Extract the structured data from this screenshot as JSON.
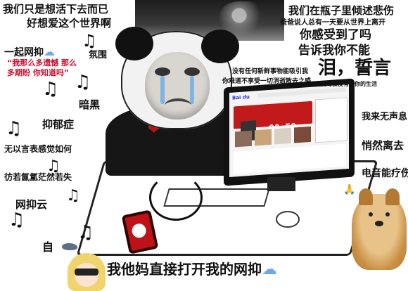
{
  "texts": {
    "t1a": "我们只是想活下去而已",
    "t1b": "好想爱这个世界啊",
    "t2": "我们在瓶子里倾述悲伤",
    "t3": "爸爸说人总有一天要从世界上离开",
    "t4": "你感受到了吗",
    "t5": "告诉我你不能",
    "t6": "一起网抑",
    "t7": "氛围",
    "t8a": "“我那么多遗憾 那么",
    "t8b": "多期盼 你知道吗”",
    "t9": "没有任何新鲜事物能吸引我",
    "t10": "你难道不享受一切消逝散去之感",
    "t11": "泪，誓言",
    "t12": "我要习惯没有了你的生活",
    "t13": "暗黑",
    "t14": "抑郁症",
    "t15": "无以言表感觉如何",
    "t16": "彷若氤氲茫然若失",
    "t17": "网抑云",
    "t18": "自",
    "t19": "我来无声息",
    "t20": "悄然离去",
    "t21": "电音能疗伤",
    "caption": "我他妈直接打开我的网抑"
  },
  "screen": {
    "logo": "Bai du",
    "clock": "00:59"
  },
  "icons": {
    "note": "♫",
    "cloud": "☁",
    "prayer": "🙏",
    "heart": "❤"
  },
  "colors": {
    "tear": "#7fb4e6",
    "player": "#c21a1a",
    "cloud": "#6ea8e8"
  }
}
